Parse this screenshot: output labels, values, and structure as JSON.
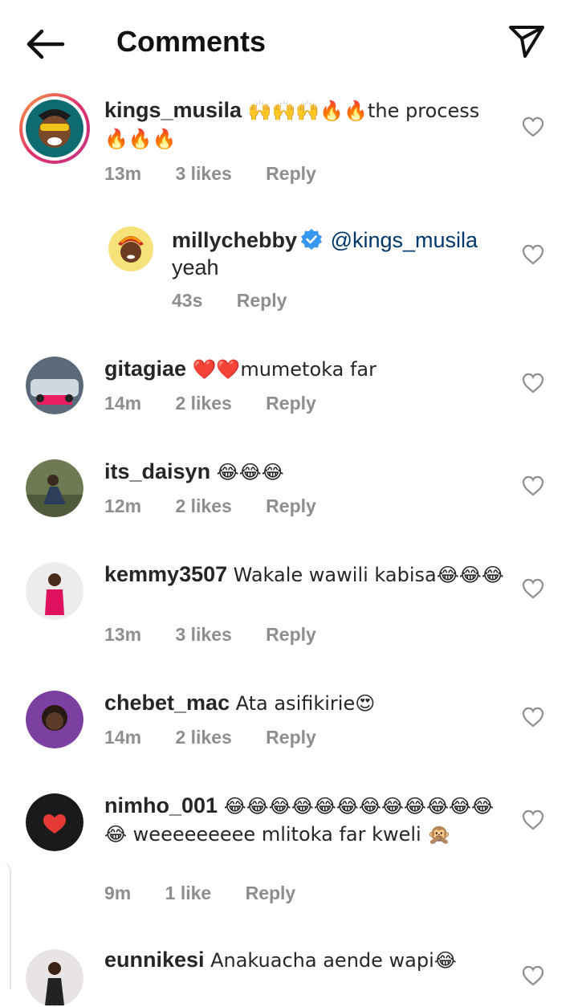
{
  "header": {
    "title": "Comments",
    "back_icon": "arrow-left-icon",
    "send_icon": "paper-plane-icon"
  },
  "comments": [
    {
      "user": "kings_musila",
      "text": "🙌🙌🙌🔥🔥the process 🔥🔥🔥",
      "time": "13m",
      "likes": "3 likes",
      "reply": "Reply"
    },
    {
      "user": "millychebby",
      "mention": "@kings_musila",
      "text": "yeah",
      "time": "43s",
      "reply": "Reply"
    },
    {
      "user": "gitagiae",
      "text": "❤️❤️mumetoka far",
      "time": "14m",
      "likes": "2 likes",
      "reply": "Reply"
    },
    {
      "user": "its_daisyn",
      "text": "😂😂😂",
      "time": "12m",
      "likes": "2 likes",
      "reply": "Reply"
    },
    {
      "user": "kemmy3507",
      "text": "Wakale wawili kabisa😂😂😂",
      "time": "13m",
      "likes": "3 likes",
      "reply": "Reply"
    },
    {
      "user": "chebet_mac",
      "text": "Ata asifikirie😍",
      "time": "14m",
      "likes": "2 likes",
      "reply": "Reply"
    },
    {
      "user": "nimho_001",
      "text": "😂😂😂😂😂😂😂😂😂😂😂😂😂 weeeeeeeee mlitoka far kweli 🙊",
      "time": "9m",
      "likes": "1 like",
      "reply": "Reply"
    },
    {
      "user": "eunnikesi",
      "text": "Anakuacha aende wapi😂"
    }
  ],
  "colors": {
    "mention": "#00376b",
    "meta": "#8e8e8e",
    "verified": "#3897f0"
  }
}
